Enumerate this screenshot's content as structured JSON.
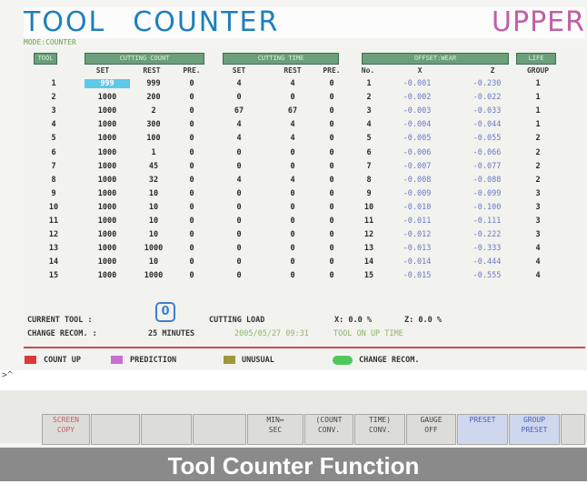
{
  "header": {
    "title_left_1": "TOOL",
    "title_left_2": "COUNTER",
    "title_right": "UPPER"
  },
  "mode_label": "MODE:COUNTER",
  "group_headers": {
    "tool": "TOOL",
    "cutting_count": "CUTTING COUNT",
    "cutting_time": "CUTTING TIME",
    "offset_wear": "OFFSET:WEAR",
    "life": "LIFE"
  },
  "col_headers": {
    "count_set": "SET",
    "count_rest": "REST",
    "count_pre": "PRE.",
    "time_set": "SET",
    "time_rest": "REST",
    "time_pre": "PRE.",
    "no": "No.",
    "x": "X",
    "z": "Z",
    "group": "GROUP"
  },
  "rows": [
    {
      "tool": "1",
      "cset": "999",
      "crest": "999",
      "cpre": "0",
      "tset": "4",
      "trest": "4",
      "tpre": "0",
      "no": "1",
      "x": "-0.001",
      "z": "-0.230",
      "group": "1"
    },
    {
      "tool": "2",
      "cset": "1000",
      "crest": "200",
      "cpre": "0",
      "tset": "0",
      "trest": "0",
      "tpre": "0",
      "no": "2",
      "x": "-0.002",
      "z": "-0.022",
      "group": "1"
    },
    {
      "tool": "3",
      "cset": "1000",
      "crest": "2",
      "cpre": "0",
      "tset": "67",
      "trest": "67",
      "tpre": "0",
      "no": "3",
      "x": "-0.003",
      "z": "-0.033",
      "group": "1"
    },
    {
      "tool": "4",
      "cset": "1000",
      "crest": "300",
      "cpre": "0",
      "tset": "4",
      "trest": "4",
      "tpre": "0",
      "no": "4",
      "x": "-0.004",
      "z": "-0.044",
      "group": "1"
    },
    {
      "tool": "5",
      "cset": "1000",
      "crest": "100",
      "cpre": "0",
      "tset": "4",
      "trest": "4",
      "tpre": "0",
      "no": "5",
      "x": "-0.005",
      "z": "-0.055",
      "group": "2"
    },
    {
      "tool": "6",
      "cset": "1000",
      "crest": "1",
      "cpre": "0",
      "tset": "0",
      "trest": "0",
      "tpre": "0",
      "no": "6",
      "x": "-0.006",
      "z": "-0.066",
      "group": "2"
    },
    {
      "tool": "7",
      "cset": "1000",
      "crest": "45",
      "cpre": "0",
      "tset": "0",
      "trest": "0",
      "tpre": "0",
      "no": "7",
      "x": "-0.007",
      "z": "-0.077",
      "group": "2"
    },
    {
      "tool": "8",
      "cset": "1000",
      "crest": "32",
      "cpre": "0",
      "tset": "4",
      "trest": "4",
      "tpre": "0",
      "no": "8",
      "x": "-0.008",
      "z": "-0.088",
      "group": "2"
    },
    {
      "tool": "9",
      "cset": "1000",
      "crest": "10",
      "cpre": "0",
      "tset": "0",
      "trest": "0",
      "tpre": "0",
      "no": "9",
      "x": "-0.009",
      "z": "-0.099",
      "group": "3"
    },
    {
      "tool": "10",
      "cset": "1000",
      "crest": "10",
      "cpre": "0",
      "tset": "0",
      "trest": "0",
      "tpre": "0",
      "no": "10",
      "x": "-0.010",
      "z": "-0.100",
      "group": "3"
    },
    {
      "tool": "11",
      "cset": "1000",
      "crest": "10",
      "cpre": "0",
      "tset": "0",
      "trest": "0",
      "tpre": "0",
      "no": "11",
      "x": "-0.011",
      "z": "-0.111",
      "group": "3"
    },
    {
      "tool": "12",
      "cset": "1000",
      "crest": "10",
      "cpre": "0",
      "tset": "0",
      "trest": "0",
      "tpre": "0",
      "no": "12",
      "x": "-0.012",
      "z": "-0.222",
      "group": "3"
    },
    {
      "tool": "13",
      "cset": "1000",
      "crest": "1000",
      "cpre": "0",
      "tset": "0",
      "trest": "0",
      "tpre": "0",
      "no": "13",
      "x": "-0.013",
      "z": "-0.333",
      "group": "4"
    },
    {
      "tool": "14",
      "cset": "1000",
      "crest": "10",
      "cpre": "0",
      "tset": "0",
      "trest": "0",
      "tpre": "0",
      "no": "14",
      "x": "-0.014",
      "z": "-0.444",
      "group": "4"
    },
    {
      "tool": "15",
      "cset": "1000",
      "crest": "1000",
      "cpre": "0",
      "tset": "0",
      "trest": "0",
      "tpre": "0",
      "no": "15",
      "x": "-0.015",
      "z": "-0.555",
      "group": "4"
    }
  ],
  "status": {
    "current_tool_label": "CURRENT TOOL :",
    "current_tool_value": "0",
    "cutting_load_label": "CUTTING LOAD",
    "x_load": "X:  0.0 %",
    "z_load": "Z:  0.0 %",
    "change_recom_label": "CHANGE RECOM. :",
    "change_recom_value": "25 MINUTES",
    "timestamp": "2005/05/27 09:31",
    "tool_message": "TOOL ON UP TIME"
  },
  "legend": [
    {
      "label": "COUNT UP",
      "color": "#d93a3a"
    },
    {
      "label": "PREDICTION",
      "color": "#c86fd0"
    },
    {
      "label": "UNUSUAL",
      "color": "#9c9a3a"
    },
    {
      "label": "CHANGE RECOM.",
      "color": "#4ec85a"
    }
  ],
  "command_line": ">^",
  "softkeys": [
    {
      "l1": "SCREEN",
      "l2": "COPY",
      "style": "red"
    },
    {
      "l1": "",
      "l2": "",
      "style": ""
    },
    {
      "l1": "",
      "l2": "",
      "style": ""
    },
    {
      "l1": "",
      "l2": "",
      "style": ""
    },
    {
      "l1": "MIN↔",
      "l2": "SEC",
      "style": ""
    },
    {
      "l1": "(COUNT",
      "l2": "CONV.",
      "style": ""
    },
    {
      "l1": "TIME)",
      "l2": "CONV.",
      "style": ""
    },
    {
      "l1": "GAUGE",
      "l2": "OFF",
      "style": ""
    },
    {
      "l1": "",
      "l2": "PRESET",
      "style": "blue"
    },
    {
      "l1": "GROUP",
      "l2": "PRESET",
      "style": "blue"
    },
    {
      "l1": "",
      "l2": "",
      "style": ""
    }
  ],
  "caption": "Tool Counter Function"
}
